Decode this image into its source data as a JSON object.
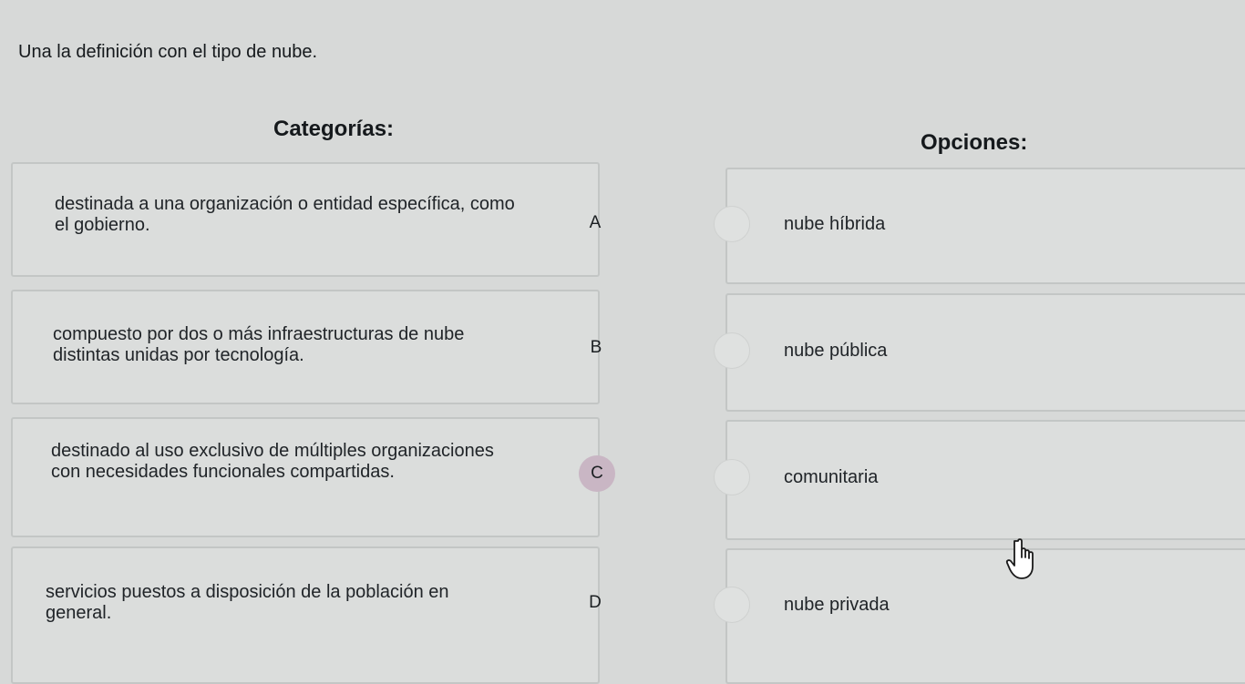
{
  "instruction": "Una la definición con el tipo de nube.",
  "headings": {
    "categories": "Categorías:",
    "options": "Opciones:"
  },
  "categories": [
    {
      "text": "destinada a una organización o entidad específica, como el gobierno.",
      "letter": "A"
    },
    {
      "text": "compuesto por dos o más infraestructuras de nube distintas unidas por tecnología.",
      "letter": "B"
    },
    {
      "text": "destinado al uso exclusivo de múltiples organizaciones con necesidades funcionales compartidas.",
      "letter": "C"
    },
    {
      "text": "servicios puestos a disposición de la población en general.",
      "letter": "D"
    }
  ],
  "options": [
    {
      "label": "nube híbrida"
    },
    {
      "label": "nube pública"
    },
    {
      "label": "comunitaria"
    },
    {
      "label": "nube privada"
    }
  ],
  "colors": {
    "letter_c_highlight": "#c9b6c4",
    "background": "#d7d9d8"
  },
  "icons": {
    "cursor": "hand-pointer-icon"
  }
}
